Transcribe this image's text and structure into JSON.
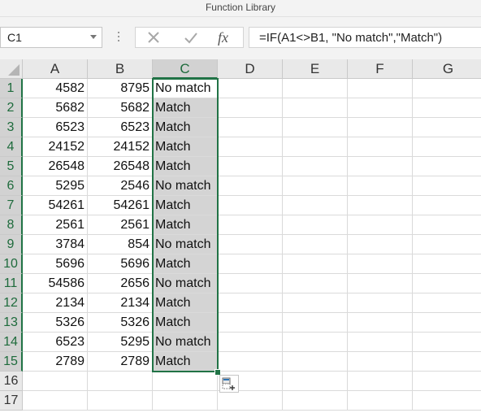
{
  "ribbon": {
    "group_label": "Function Library"
  },
  "formula_bar": {
    "name_box": "C1",
    "cancel_icon": "x-icon",
    "enter_icon": "check-icon",
    "fx_label": "fx",
    "formula": "=IF(A1<>B1, \"No match\",\"Match\")"
  },
  "sheet": {
    "columns": [
      "A",
      "B",
      "C",
      "D",
      "E",
      "F",
      "G"
    ],
    "selected_column": "C",
    "rows": [
      {
        "num": "1",
        "a": "4582",
        "b": "8795",
        "c": "No match"
      },
      {
        "num": "2",
        "a": "5682",
        "b": "5682",
        "c": "Match"
      },
      {
        "num": "3",
        "a": "6523",
        "b": "6523",
        "c": "Match"
      },
      {
        "num": "4",
        "a": "24152",
        "b": "24152",
        "c": "Match"
      },
      {
        "num": "5",
        "a": "26548",
        "b": "26548",
        "c": "Match"
      },
      {
        "num": "6",
        "a": "5295",
        "b": "2546",
        "c": "No match"
      },
      {
        "num": "7",
        "a": "54261",
        "b": "54261",
        "c": "Match"
      },
      {
        "num": "8",
        "a": "2561",
        "b": "2561",
        "c": "Match"
      },
      {
        "num": "9",
        "a": "3784",
        "b": "854",
        "c": "No match"
      },
      {
        "num": "10",
        "a": "5696",
        "b": "5696",
        "c": "Match"
      },
      {
        "num": "11",
        "a": "54586",
        "b": "2656",
        "c": "No match"
      },
      {
        "num": "12",
        "a": "2134",
        "b": "2134",
        "c": "Match"
      },
      {
        "num": "13",
        "a": "5326",
        "b": "5326",
        "c": "Match"
      },
      {
        "num": "14",
        "a": "6523",
        "b": "5295",
        "c": "No match"
      },
      {
        "num": "15",
        "a": "2789",
        "b": "2789",
        "c": "Match"
      },
      {
        "num": "16",
        "a": "",
        "b": "",
        "c": ""
      },
      {
        "num": "17",
        "a": "",
        "b": "",
        "c": ""
      }
    ]
  },
  "colors": {
    "accent": "#217346",
    "selection_fill": "#d4d4d4"
  },
  "icons": {
    "quick_analysis": "quick-analysis-icon"
  }
}
